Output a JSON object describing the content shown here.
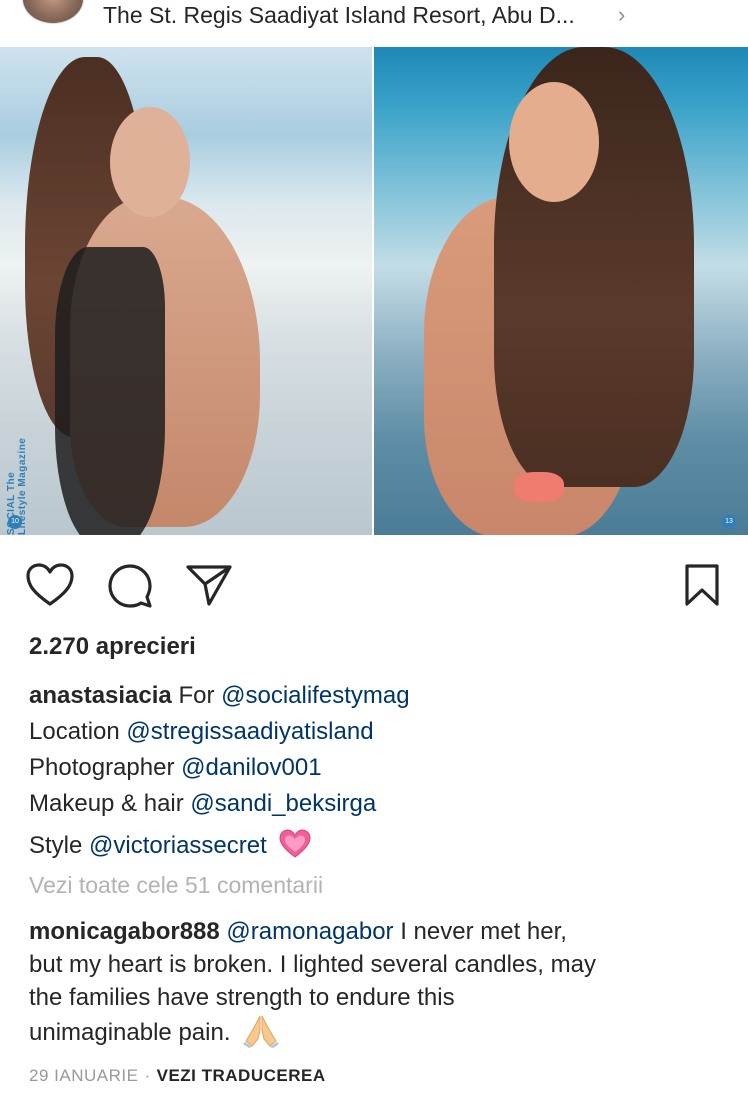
{
  "header": {
    "location": "The St. Regis Saadiyat Island Resort, Abu D...",
    "chevron": "›"
  },
  "photos": {
    "left_watermark": "SOCIAL The Lifestyle Magazine",
    "left_badge": "10",
    "right_badge": "13"
  },
  "actions": {
    "icons": [
      "heart-icon",
      "comment-icon",
      "share-icon",
      "bookmark-icon"
    ]
  },
  "likes": "2.270 aprecieri",
  "caption": {
    "username": "anastasiacia",
    "line1_text": "For ",
    "line1_mention": "@socialifestymag",
    "line2_text": "Location ",
    "line2_mention": "@stregissaadiyatisland",
    "line3_text": "Photographer ",
    "line3_mention": "@danilov001",
    "line4_text": "Makeup & hair ",
    "line4_mention": "@sandi_beksirga",
    "line5_text": "Style ",
    "line5_mention": "@victoriassecret"
  },
  "view_comments": "Vezi toate cele 51 comentarii",
  "comment": {
    "username": "monicagabor888",
    "mention": "@ramonagabor",
    "text_line1": " I never met her,",
    "text_line2": "but my heart is broken. I lighted several candles, may",
    "text_line3": "the families have strength to endure this",
    "text_line4": "unimaginable pain."
  },
  "meta": {
    "date": "29 IANUARIE",
    "separator": "·",
    "translate": "VEZI TRADUCEREA"
  },
  "colors": {
    "mention": "#003569",
    "muted": "#999999",
    "text": "#262626"
  }
}
